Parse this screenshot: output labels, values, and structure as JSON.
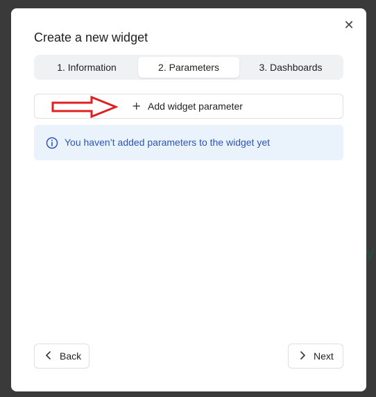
{
  "backdrop": {
    "glyph": "y!"
  },
  "modal": {
    "title": "Create a new widget",
    "close_icon": "close-icon",
    "tabs": [
      {
        "label": "1. Information",
        "active": false
      },
      {
        "label": "2. Parameters",
        "active": true
      },
      {
        "label": "3. Dashboards",
        "active": false
      }
    ],
    "add_parameter": {
      "icon": "plus-icon",
      "label": "Add widget parameter"
    },
    "annotation": {
      "icon": "red-arrow",
      "color": "#e02020"
    },
    "info": {
      "icon": "info-icon",
      "text": "You haven’t added parameters to the widget yet",
      "color": "#2b55b8"
    },
    "footer": {
      "back_label": "Back",
      "next_label": "Next"
    }
  }
}
